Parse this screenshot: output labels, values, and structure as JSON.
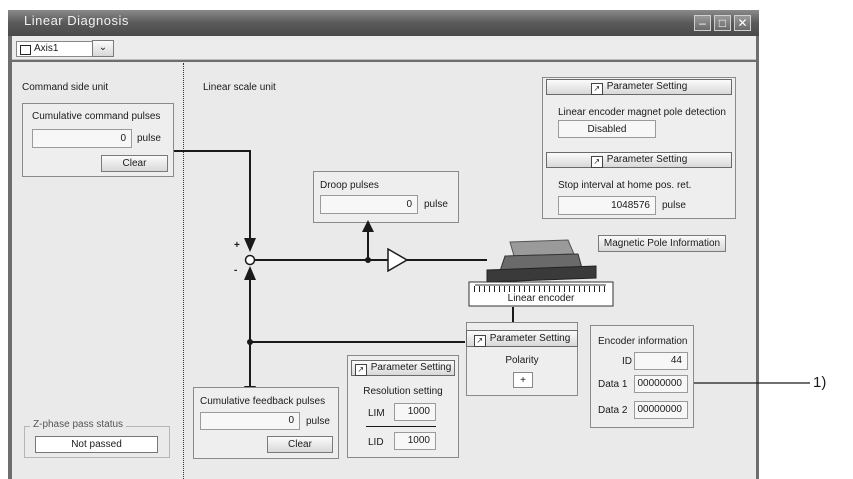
{
  "window": {
    "title": "Linear Diagnosis"
  },
  "toolbar": {
    "axis_value": "Axis1"
  },
  "command_side": {
    "section_label": "Command side unit",
    "box_title": "Cumulative command pulses",
    "value": "0",
    "unit": "pulse",
    "clear_label": "Clear"
  },
  "linear_scale": {
    "section_label": "Linear scale unit"
  },
  "params_top": {
    "button1": "Parameter Setting",
    "magnet_label": "Linear encoder magnet pole detection",
    "magnet_value": "Disabled",
    "button2": "Parameter Setting",
    "stop_label": "Stop interval at home pos. ret.",
    "stop_value": "1048576",
    "stop_unit": "pulse"
  },
  "droop": {
    "title": "Droop pulses",
    "value": "0",
    "unit": "pulse"
  },
  "magnetic_pole_button": "Magnetic Pole Information",
  "encoder_label": "Linear encoder",
  "polarity": {
    "button": "Parameter Setting",
    "label": "Polarity",
    "value": "+"
  },
  "encoder_info": {
    "title": "Encoder information",
    "id_label": "ID",
    "id_value": "44",
    "data1_label": "Data 1",
    "data1_value": "00000000",
    "data2_label": "Data 2",
    "data2_value": "00000000"
  },
  "resolution": {
    "button": "Parameter Setting",
    "title": "Resolution setting",
    "lim_label": "LIM",
    "lim_value": "1000",
    "lid_label": "LID",
    "lid_value": "1000"
  },
  "feedback": {
    "title": "Cumulative feedback pulses",
    "value": "0",
    "unit": "pulse",
    "clear_label": "Clear"
  },
  "zphase": {
    "title": "Z-phase pass status",
    "value": "Not passed"
  },
  "summing": {
    "plus": "+",
    "minus": "-"
  },
  "callout": "1)"
}
